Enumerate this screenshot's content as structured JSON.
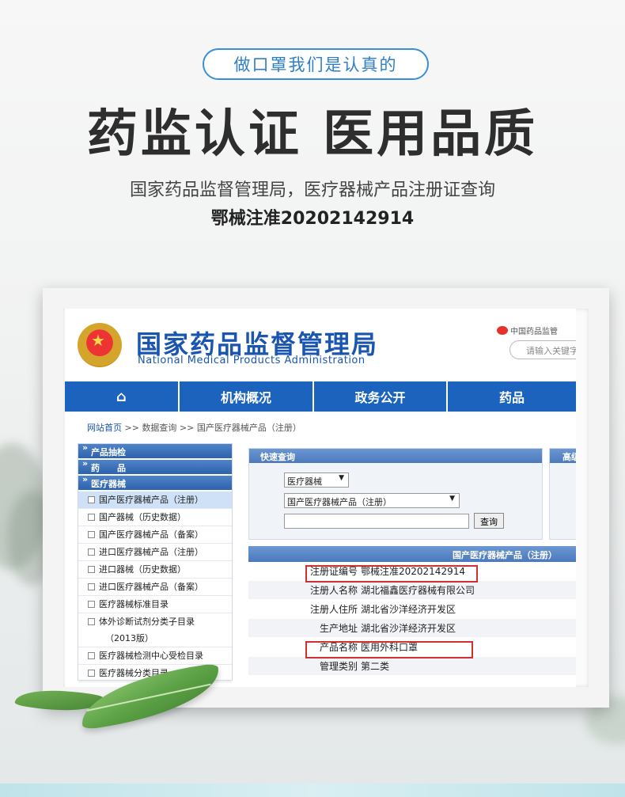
{
  "hero": {
    "pill": "做口罩我们是认真的",
    "headline": "药监认证 医用品质",
    "subtitle": "国家药品监督管理局，医疗器械产品注册证查询",
    "reg_number": "鄂械注准20202142914"
  },
  "site": {
    "title_cn": "国家药品监督管理局",
    "title_en": "National Medical Products Administration",
    "weibo_label": "中国药品监管",
    "search_placeholder": "请输入关键字",
    "nav": {
      "home_icon": "⌂",
      "items": [
        "机构概况",
        "政务公开",
        "药品"
      ]
    },
    "breadcrumb": {
      "home": "网站首页",
      "sep": ">>",
      "b1": "数据查询",
      "b2": "国产医疗器械产品（注册）"
    }
  },
  "sidebar": {
    "cats": [
      "产品抽检",
      "药　　品",
      "医疗器械"
    ],
    "items": [
      "国产医疗器械产品（注册）",
      "国产器械（历史数据）",
      "国产医疗器械产品（备案）",
      "进口医疗器械产品（注册）",
      "进口器械（历史数据）",
      "进口医疗器械产品（备案）",
      "医疗器械标准目录",
      "体外诊断试剂分类子目录",
      "（2013版）",
      "医疗器械检测中心受检目录",
      "医疗器械分类目录"
    ]
  },
  "quick": {
    "title": "快速查询",
    "select1": "医疗器械",
    "select2": "国产医疗器械产品（注册）",
    "button": "查询",
    "right_title": "高级"
  },
  "result": {
    "title": "国产医疗器械产品（注册）",
    "rows": [
      {
        "k": "注册证编号",
        "v": "鄂械注准20202142914"
      },
      {
        "k": "注册人名称",
        "v": "湖北福鑫医疗器械有限公司"
      },
      {
        "k": "注册人住所",
        "v": "湖北省沙洋经济开发区"
      },
      {
        "k": "生产地址",
        "v": "湖北省沙洋经济开发区"
      },
      {
        "k": "产品名称",
        "v": "医用外科口罩"
      },
      {
        "k": "管理类别",
        "v": "第二类"
      }
    ]
  },
  "colors": {
    "brand_blue": "#1c63be",
    "highlight_red": "#d03030",
    "pill_blue": "#3a8ed8"
  }
}
